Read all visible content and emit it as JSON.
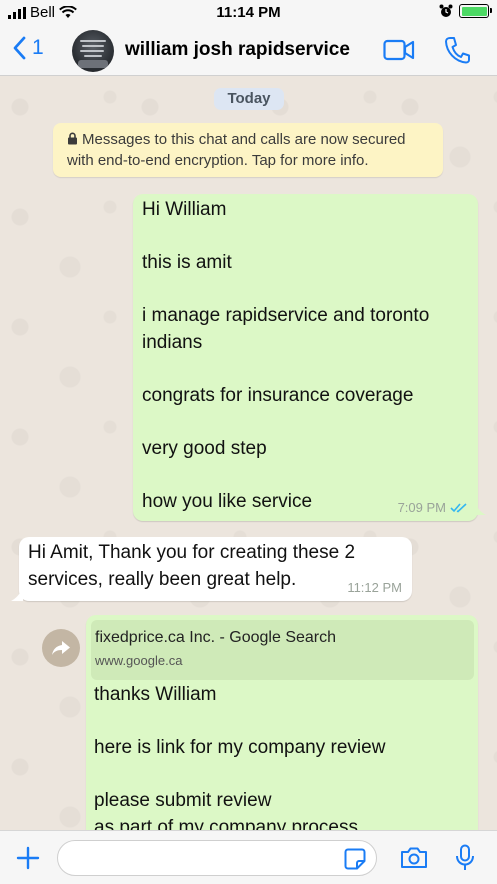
{
  "status_bar": {
    "carrier": "Bell",
    "time": "11:14 PM",
    "battery_percent": 100
  },
  "header": {
    "back_count": "1",
    "contact_name": "william josh rapidservice",
    "video_call_icon": "video-camera-icon",
    "voice_call_icon": "phone-icon"
  },
  "chat": {
    "date_label": "Today",
    "encryption_notice": "Messages to this chat and calls are now secured with end-to-end encryption. Tap for more info.",
    "messages": [
      {
        "direction": "outgoing",
        "text": "Hi William\n\nthis is amit\n\ni manage rapidservice and toronto indians\n\ncongrats for insurance coverage\n\nvery good step\n\nhow you like service",
        "time": "7:09 PM",
        "status": "read"
      },
      {
        "direction": "incoming",
        "text": "Hi Amit, Thank you for creating these 2 services, really been great help.",
        "time": "11:12 PM"
      },
      {
        "direction": "outgoing",
        "link_preview": {
          "title": "fixedprice.ca Inc. - Google Search",
          "url": "www.google.ca"
        },
        "text": "thanks William\n\nhere is link for my company review\n\nplease submit review\nas part of my company process"
      }
    ]
  },
  "colors": {
    "accent": "#1a7cf5",
    "outgoing_bubble": "#dcf8c6",
    "incoming_bubble": "#ffffff",
    "read_ticks": "#34b7f1",
    "encryption_bg": "#fdf4c5"
  },
  "input_bar": {
    "placeholder": "",
    "attach_icon": "plus-icon",
    "sticker_icon": "sticker-icon",
    "camera_icon": "camera-icon",
    "mic_icon": "microphone-icon"
  }
}
